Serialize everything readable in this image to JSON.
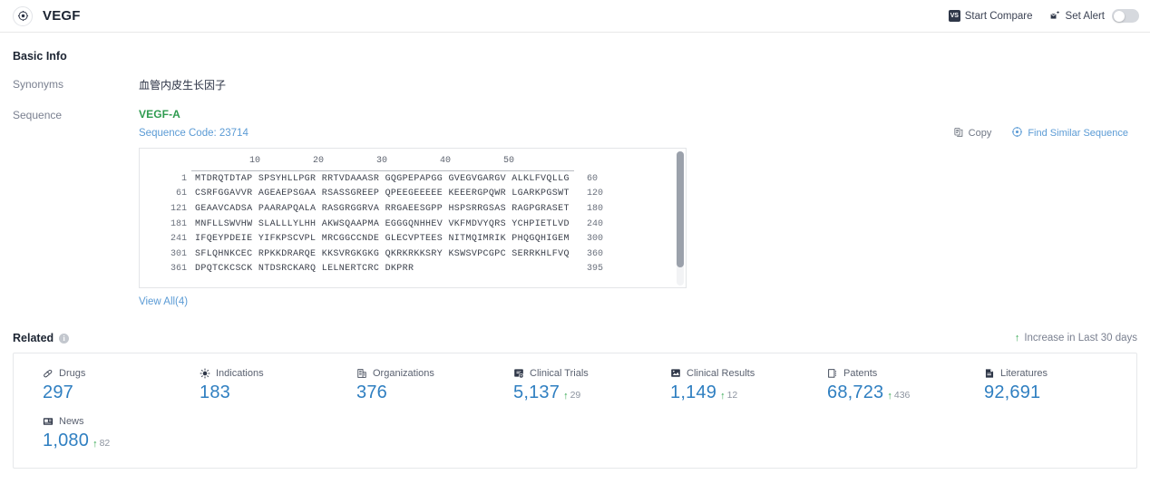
{
  "header": {
    "logo_icon": "target-icon",
    "title": "VEGF",
    "start_compare": {
      "label": "Start Compare",
      "badge": "VS",
      "icon": "vs-badge-icon"
    },
    "set_alert": {
      "label": "Set Alert",
      "icon": "alert-bell-icon",
      "toggle_state": "off"
    }
  },
  "basic_info": {
    "section_title": "Basic Info",
    "rows": {
      "synonyms_label": "Synonyms",
      "synonyms_value": "血管内皮生长因子",
      "sequence_label": "Sequence"
    }
  },
  "sequence": {
    "name": "VEGF-A",
    "code_label": "Sequence Code: 23714",
    "copy_label": "Copy",
    "copy_icon": "copy-icon",
    "find_similar_label": "Find Similar Sequence",
    "find_similar_icon": "find-similar-icon",
    "ruler": [
      "10",
      "20",
      "30",
      "40",
      "50"
    ],
    "rows": [
      {
        "start": "1",
        "chunks": "MTDRQTDTAP SPSYHLLPGR RRTVDAAASR GQGPEPAPGG GVEGVGARGV ALKLFVQLLG",
        "end": "60"
      },
      {
        "start": "61",
        "chunks": "CSRFGGAVVR AGEAEPSGAA RSASSGREEP QPEEGEEEEE KEEERGPQWR LGARKPGSWT",
        "end": "120"
      },
      {
        "start": "121",
        "chunks": "GEAAVCADSA PAARAPQALA RASGRGGRVA RRGAEESGPP HSPSRRGSAS RAGPGRASET",
        "end": "180"
      },
      {
        "start": "181",
        "chunks": "MNFLLSWVHW SLALLLYLHH AKWSQAAPMA EGGGQNHHEV VKFMDVYQRS YCHPIETLVD",
        "end": "240"
      },
      {
        "start": "241",
        "chunks": "IFQEYPDEIE YIFKPSCVPL MRCGGCCNDE GLECVPTEES NITMQIMRIK PHQGQHIGEM",
        "end": "300"
      },
      {
        "start": "301",
        "chunks": "SFLQHNKCEC RPKKDRARQE KKSVRGKGKG QKRKRKKSRY KSWSVPCGPC SERRKHLFVQ",
        "end": "360"
      },
      {
        "start": "361",
        "chunks": "DPQTCKCSCK NTDSRCKARQ LELNERTCRC DKPRR",
        "end": "395"
      }
    ],
    "view_all_label": "View All(4)"
  },
  "related": {
    "title": "Related",
    "info_icon": "info-icon",
    "legend": "Increase in Last 30 days",
    "legend_icon": "up-arrow-icon",
    "stats": [
      {
        "label": "Drugs",
        "icon": "pill-icon",
        "value": "297",
        "delta": ""
      },
      {
        "label": "Indications",
        "icon": "virus-icon",
        "value": "183",
        "delta": ""
      },
      {
        "label": "Organizations",
        "icon": "building-icon",
        "value": "376",
        "delta": ""
      },
      {
        "label": "Clinical Trials",
        "icon": "clinical-trial-icon",
        "value": "5,137",
        "delta": "29"
      },
      {
        "label": "Clinical Results",
        "icon": "clinical-result-icon",
        "value": "1,149",
        "delta": "12"
      },
      {
        "label": "Patents",
        "icon": "patent-icon",
        "value": "68,723",
        "delta": "436"
      },
      {
        "label": "Literatures",
        "icon": "literature-icon",
        "value": "92,691",
        "delta": ""
      },
      {
        "label": "News",
        "icon": "news-icon",
        "value": "1,080",
        "delta": "82"
      }
    ]
  },
  "colors": {
    "accent_blue": "#2f7fc1",
    "link_blue": "#5b9bd5",
    "green": "#2e9b4f",
    "up_green": "#36a852",
    "dark": "#1c2432"
  }
}
